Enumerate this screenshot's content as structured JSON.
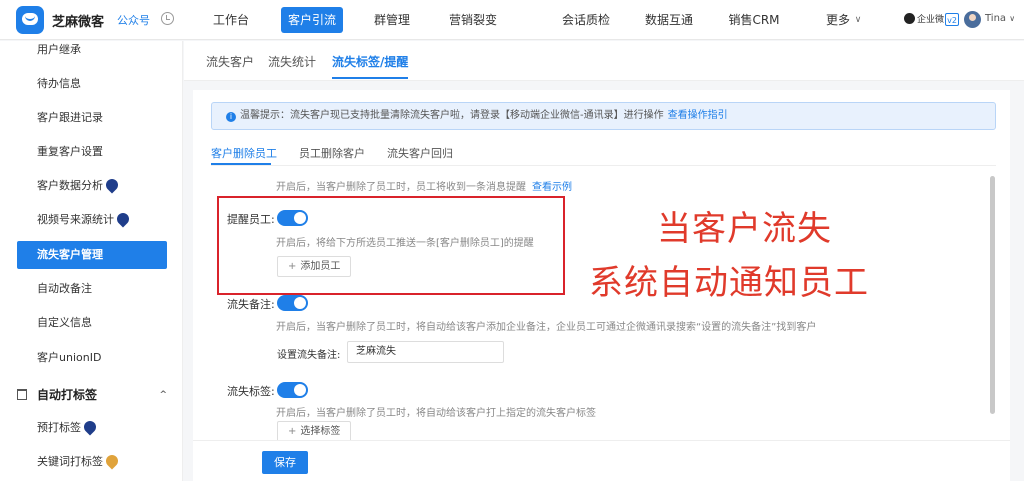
{
  "brand": {
    "name": "芝麻微客",
    "account": "公众号"
  },
  "nav": {
    "items": [
      "工作台",
      "客户引流",
      "群管理",
      "营销裂变",
      "会话质检",
      "数据互通",
      "销售CRM",
      "更多"
    ],
    "active_index": 1,
    "more_caret": "∨"
  },
  "header_right": {
    "wechat_work": "企业微",
    "version": "v2",
    "user": "Tina",
    "user_caret": "∨"
  },
  "sidebar": {
    "items": [
      "用户继承",
      "待办信息",
      "客户跟进记录",
      "重复客户设置",
      "客户数据分析",
      "视频号来源统计",
      "流失客户管理",
      "自动改备注",
      "自定义信息",
      "客户unionID"
    ],
    "active_index": 6,
    "group": {
      "label": "自动打标签",
      "caret": "^"
    },
    "group_items": [
      "预打标签",
      "关键词打标签"
    ]
  },
  "subtabs": [
    "流失客户",
    "流失统计",
    "流失标签/提醒"
  ],
  "subtab_active": 2,
  "notice": {
    "icon": "i",
    "text": "温馨提示：流失客户现已支持批量清除流失客户啦，请登录【移动端企业微信-通讯录】进行操作",
    "link": "查看操作指引"
  },
  "inner_tabs": [
    "客户删除员工",
    "员工删除客户",
    "流失客户回归"
  ],
  "inner_tab_active": 0,
  "section_top": {
    "help": "开启后，当客户删除了员工时，员工将收到一条消息提醒",
    "link": "查看示例"
  },
  "remind": {
    "label": "提醒员工:",
    "enabled": true,
    "help": "开启后，将给下方所选员工推送一条[客户删除员工]的提醒",
    "add_button": "添加员工",
    "plus": "+"
  },
  "remark": {
    "label": "流失备注:",
    "enabled": true,
    "help": "开启后，当客户删除了员工时，将自动给该客户添加企业备注，企业员工可通过企微通讯录搜索“设置的流失备注”找到客户",
    "input_label": "设置流失备注:",
    "input_value": "芝麻流失"
  },
  "tag": {
    "label": "流失标签:",
    "enabled": true,
    "help": "开启后，当客户删除了员工时，将自动给该客户打上指定的流失客户标签",
    "select_button": "选择标签",
    "plus": "+"
  },
  "overlay": {
    "line1": "当客户流失",
    "line2": "系统自动通知员工"
  },
  "footer": {
    "save": "保存"
  },
  "colors": {
    "primary": "#1f7fe8",
    "annotation_red": "#e03a2b"
  }
}
